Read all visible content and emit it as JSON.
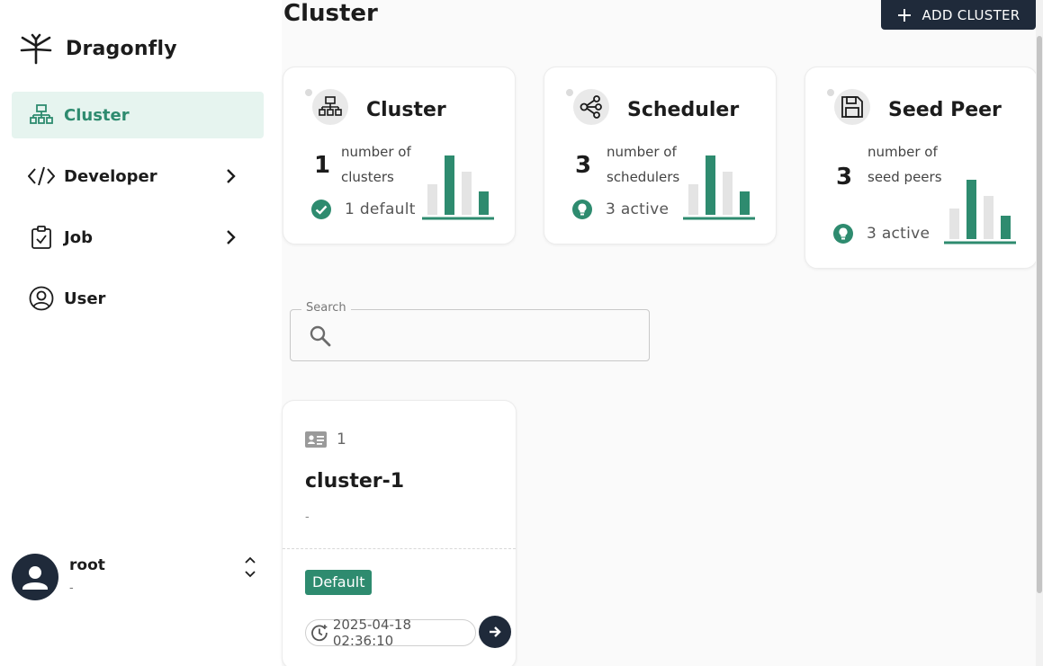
{
  "brand": {
    "name": "Dragonfly"
  },
  "sidebar": {
    "items": [
      {
        "label": "Cluster",
        "icon": "sitemap-icon",
        "active": true
      },
      {
        "label": "Developer",
        "icon": "code-icon",
        "expandable": true
      },
      {
        "label": "Job",
        "icon": "clipboard-check-icon",
        "expandable": true
      },
      {
        "label": "User",
        "icon": "user-circle-icon"
      }
    ],
    "user": {
      "name": "root",
      "sub": "-"
    }
  },
  "header": {
    "title": "Cluster",
    "add_label": "ADD CLUSTER"
  },
  "stats": [
    {
      "title": "Cluster",
      "count": "1",
      "desc": "number of clusters",
      "status": "1 default",
      "icon": "sitemap-icon",
      "status_icon": "check-circle-icon"
    },
    {
      "title": "Scheduler",
      "count": "3",
      "desc": "number of schedulers",
      "status": "3 active",
      "icon": "share-nodes-icon",
      "status_icon": "lightbulb-icon"
    },
    {
      "title": "Seed Peer",
      "count": "3",
      "desc": "number of seed peers",
      "status": "3 active",
      "icon": "save-icon",
      "status_icon": "lightbulb-icon"
    }
  ],
  "search": {
    "label": "Search",
    "value": ""
  },
  "clusters": [
    {
      "id": "1",
      "name": "cluster-1",
      "description": "-",
      "badge": "Default",
      "created": "2025-04-18 02:36:10"
    }
  ],
  "colors": {
    "accent": "#2e8b6f",
    "dark": "#1f2a3a",
    "bar_muted": "#e4e4e4",
    "active_bg": "#e6f4ef"
  }
}
